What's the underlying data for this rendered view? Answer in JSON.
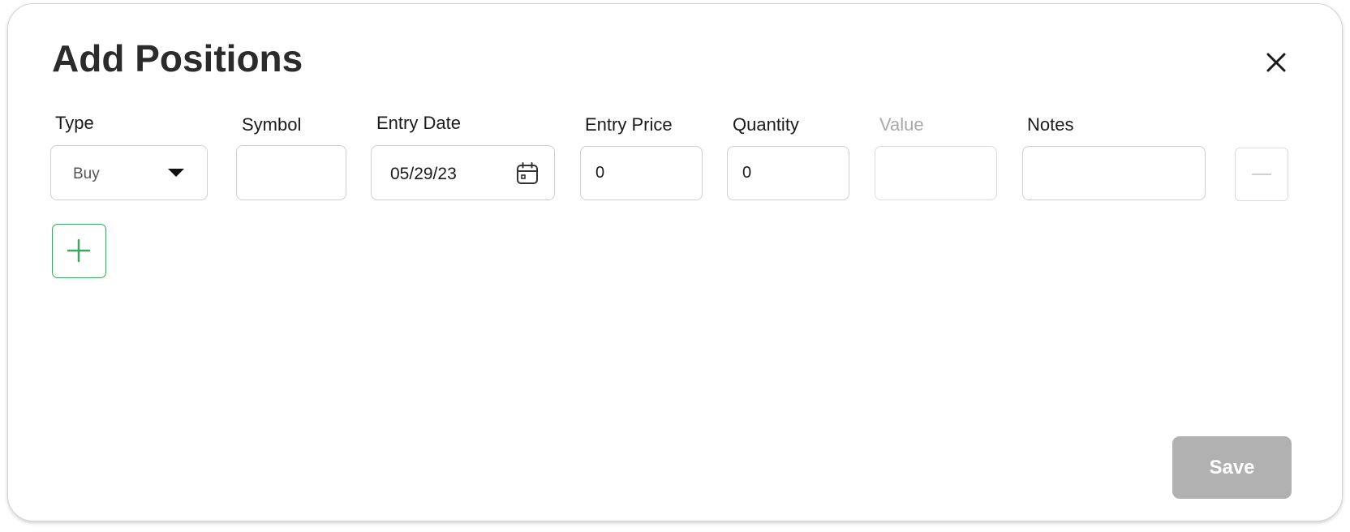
{
  "dialog": {
    "title": "Add Positions",
    "close_icon": "close-icon"
  },
  "fields": {
    "type": {
      "label": "Type",
      "value": "Buy",
      "icon": "chevron-down-icon"
    },
    "symbol": {
      "label": "Symbol",
      "value": ""
    },
    "entry_date": {
      "label": "Entry Date",
      "value": "05/29/23",
      "icon": "calendar-icon"
    },
    "entry_price": {
      "label": "Entry Price",
      "value": "0"
    },
    "quantity": {
      "label": "Quantity",
      "value": "0"
    },
    "value": {
      "label": "Value",
      "value": "",
      "disabled": true
    },
    "notes": {
      "label": "Notes",
      "value": ""
    }
  },
  "row_actions": {
    "remove_icon": "minus-icon",
    "add_icon": "plus-icon"
  },
  "footer": {
    "save_label": "Save",
    "save_disabled": true
  },
  "colors": {
    "accent_green": "#3aa860",
    "save_disabled_bg": "#b1b1b1",
    "border": "#cfcfcf",
    "disabled_text": "#a9a9a9"
  }
}
